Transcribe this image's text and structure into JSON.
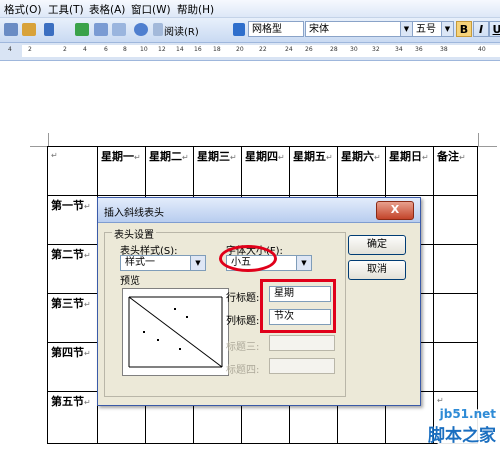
{
  "menu": [
    "格式(O)",
    "工具(T)",
    "表格(A)",
    "窗口(W)",
    "帮助(H)"
  ],
  "toolbar": {
    "read_label": "阅读(R)",
    "style_value": "网格型",
    "font_value": "宋体",
    "size_value": "五号",
    "bold": "B",
    "italic": "I",
    "underline": "U"
  },
  "ruler": [
    "4",
    "2",
    "2",
    "4",
    "6",
    "8",
    "10",
    "12",
    "14",
    "16",
    "18",
    "20",
    "22",
    "24",
    "26",
    "28",
    "30",
    "32",
    "34",
    "36",
    "38",
    "40"
  ],
  "table": {
    "header": [
      "星期一",
      "星期二",
      "星期三",
      "星期四",
      "星期五",
      "星期六",
      "星期日",
      "备注"
    ],
    "rows": [
      "第一节",
      "第二节",
      "第三节",
      "第四节",
      "第五节"
    ]
  },
  "dialog": {
    "title": "插入斜线表头",
    "close": "X",
    "group_label": "表头设置",
    "style_label": "表头样式(S):",
    "style_value": "样式一",
    "fontsize_label": "字体大小(F):",
    "fontsize_value": "小五",
    "preview_label": "预览",
    "row_title_label": "行标题:",
    "row_title_value": "星期",
    "col_title_label": "列标题:",
    "col_title_value": "节次",
    "title3_label": "标题三:",
    "title4_label": "标题四:",
    "ok": "确定",
    "cancel": "取消"
  },
  "watermark": {
    "url": "jb51.net",
    "name": "脚本之家"
  },
  "colors": {
    "annotation": "#e0001a",
    "dialog_bg": "#ece9d8"
  }
}
